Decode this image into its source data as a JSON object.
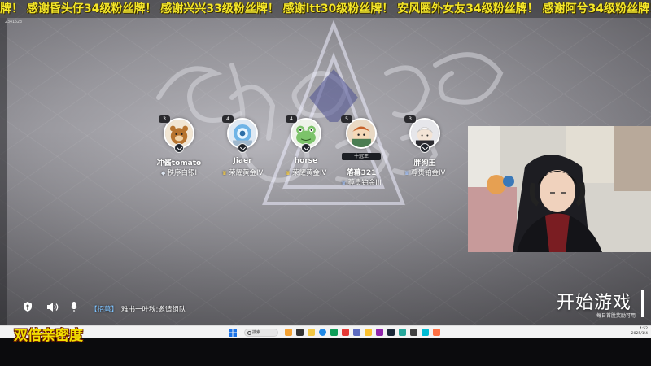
{
  "banner": {
    "text": "牌！ 感谢昏头仔34级粉丝牌！ 感谢兴兴33级粉丝牌！ 感谢ltt30级粉丝牌！ 安风圈外女友34级粉丝牌！ 感谢阿兮34级粉丝牌！"
  },
  "stream_id": "2341523",
  "players": [
    {
      "name": "冲酱tomato",
      "rank": "秩序白银I",
      "level": "3",
      "rank_tier": "silver",
      "title": ""
    },
    {
      "name": "Jiaer",
      "rank": "荣耀黄金IV",
      "level": "4",
      "rank_tier": "gold",
      "title": ""
    },
    {
      "name": "horse",
      "rank": "荣耀黄金IV",
      "level": "4",
      "rank_tier": "gold",
      "title": ""
    },
    {
      "name": "落幕321",
      "rank": "尊贵铂金III",
      "level": "5",
      "rank_tier": "plat",
      "title": "十冠王"
    },
    {
      "name": "胖狗王",
      "rank": "尊贵铂金IV",
      "level": "3",
      "rank_tier": "plat",
      "title": ""
    }
  ],
  "team_invite": {
    "tag": "【招募】",
    "text": "难书一叶秋:邀请组队"
  },
  "start_button": {
    "label": "开始游戏",
    "sub": "每日首胜奖励可用"
  },
  "taskbar": {
    "search": "搜索",
    "time": "4:52",
    "date": "2025/1/4"
  },
  "overlay": {
    "text": "双倍亲密度"
  },
  "colors": {
    "banner_yellow": "#f4e629",
    "overlay_yellow": "#f3e000",
    "tag_blue": "#7fc4ff"
  }
}
